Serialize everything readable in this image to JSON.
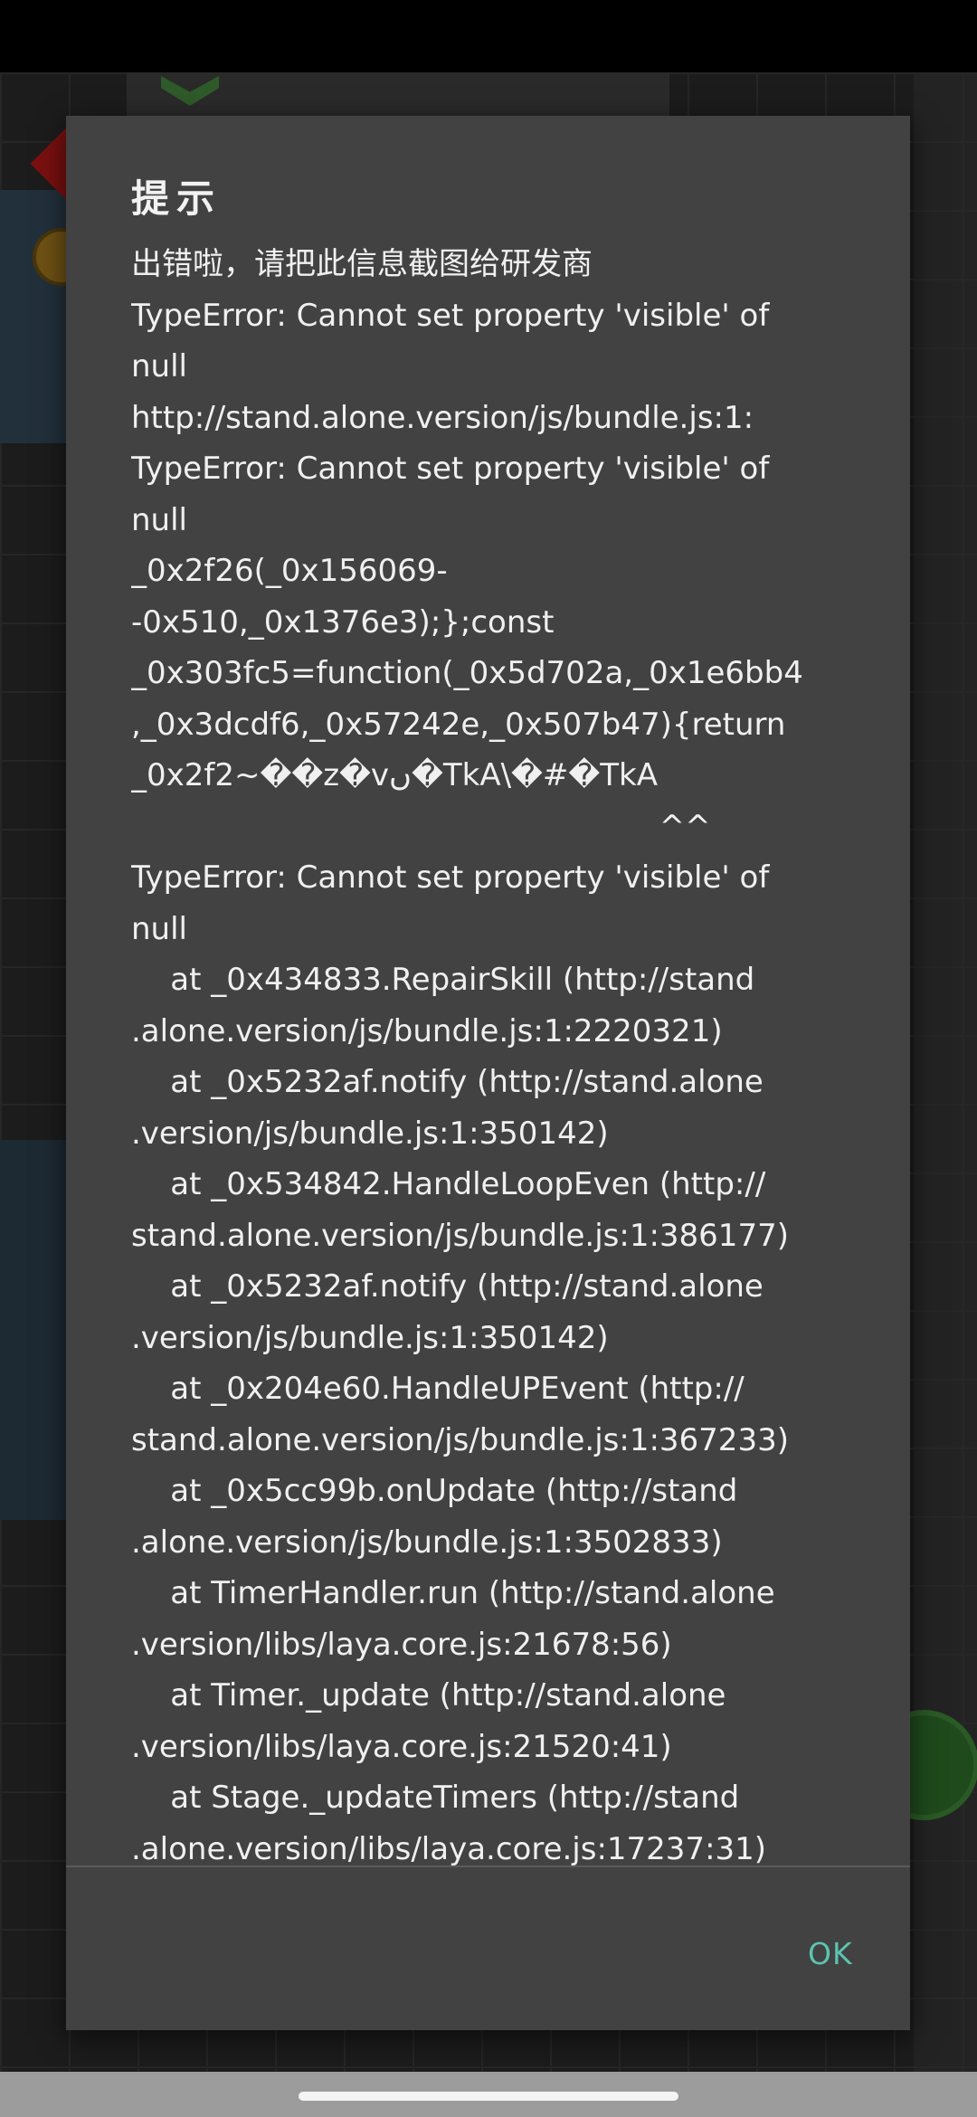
{
  "dialog": {
    "title": "提示",
    "message": "出错啦，请把此信息截图给研发商\nTypeError: Cannot set property 'visible' of\nnull\nhttp://stand.alone.version/js/bundle.js:1:\nTypeError: Cannot set property 'visible' of\nnull\n_0x2f26(_0x156069-\n-0x510,_0x1376e3);};const\n_0x303fc5=function(_0x5d702a,_0x1e6bb4\n,_0x3dcdf6,_0x57242e,_0x507b47){return\n_0x2f2~��z�vں�TkA\\�#�TkA\n                                                      ^^\nTypeError: Cannot set property 'visible' of\nnull\n    at _0x434833.RepairSkill (http://stand\n.alone.version/js/bundle.js:1:2220321)\n    at _0x5232af.notify (http://stand.alone\n.version/js/bundle.js:1:350142)\n    at _0x534842.HandleLoopEven (http://\nstand.alone.version/js/bundle.js:1:386177)\n    at _0x5232af.notify (http://stand.alone\n.version/js/bundle.js:1:350142)\n    at _0x204e60.HandleUPEvent (http://\nstand.alone.version/js/bundle.js:1:367233)\n    at _0x5cc99b.onUpdate (http://stand\n.alone.version/js/bundle.js:1:3502833)\n    at TimerHandler.run (http://stand.alone\n.version/libs/laya.core.js:21678:56)\n    at Timer._update (http://stand.alone\n.version/libs/laya.core.js:21520:41)\n    at Stage._updateTimers (http://stand\n.alone.version/libs/laya.core.js:17237:31)",
    "ok_label": "OK",
    "accent_color": "#5cc4b0"
  }
}
